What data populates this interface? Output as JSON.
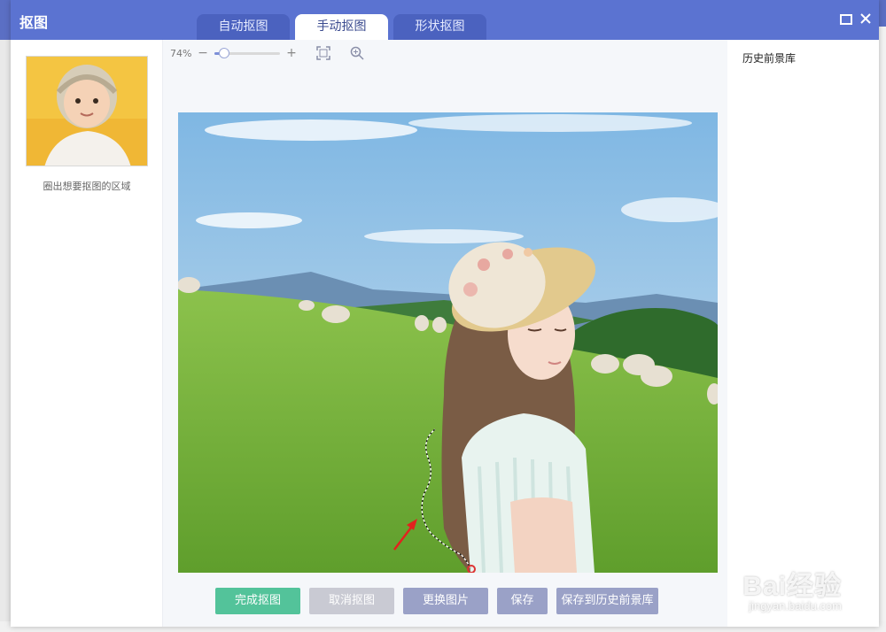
{
  "dialog": {
    "title": "抠图",
    "tabs": [
      {
        "label": "自动抠图",
        "active": false
      },
      {
        "label": "手动抠图",
        "active": true
      },
      {
        "label": "形状抠图",
        "active": false
      }
    ],
    "maximize_icon": "maximize-icon",
    "close_icon": "close-icon"
  },
  "left_panel": {
    "caption": "圈出想要抠图的区域"
  },
  "toolbar": {
    "zoom_value": "74%",
    "zoom_level": 0.15,
    "icons": [
      "zoom-out-icon",
      "zoom-in-icon",
      "fit-screen-icon",
      "magnifier-icon"
    ]
  },
  "actions": {
    "finish": "完成抠图",
    "cancel": "取消抠图",
    "replace": "更换图片",
    "save": "保存",
    "save_history": "保存到历史前景库"
  },
  "right_panel": {
    "title": "历史前景库"
  },
  "watermark": {
    "top": "Bai经验",
    "bottom": "jingyan.baidu.com"
  },
  "colors": {
    "titlebar": "#5b73d1",
    "finish_button": "#53c39a",
    "secondary_button": "#9aa1c7",
    "disabled_button": "#c9cad3"
  }
}
